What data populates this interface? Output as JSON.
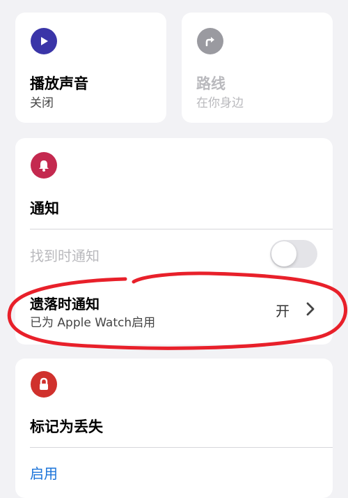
{
  "tiles": {
    "play_sound": {
      "title": "播放声音",
      "status": "关闭",
      "icon": "play-icon",
      "icon_color": "#3a35a8"
    },
    "directions": {
      "title": "路线",
      "status": "在你身边",
      "icon": "arrow-turn-right-icon",
      "icon_color": "#9a9aa0"
    }
  },
  "notifications": {
    "icon": "bell-icon",
    "icon_color": "#c4294f",
    "title": "通知",
    "notify_when_found": {
      "label": "找到时通知",
      "toggle_on": false
    },
    "notify_when_left_behind": {
      "label": "遗落时通知",
      "subtitle": "已为 Apple Watch启用",
      "value": "开"
    }
  },
  "mark_as_lost": {
    "icon": "lock-icon",
    "icon_color": "#d0312d",
    "title": "标记为丢失",
    "action": "启用",
    "action_color": "#1a73d9"
  },
  "annotation_color": "#e8202a"
}
